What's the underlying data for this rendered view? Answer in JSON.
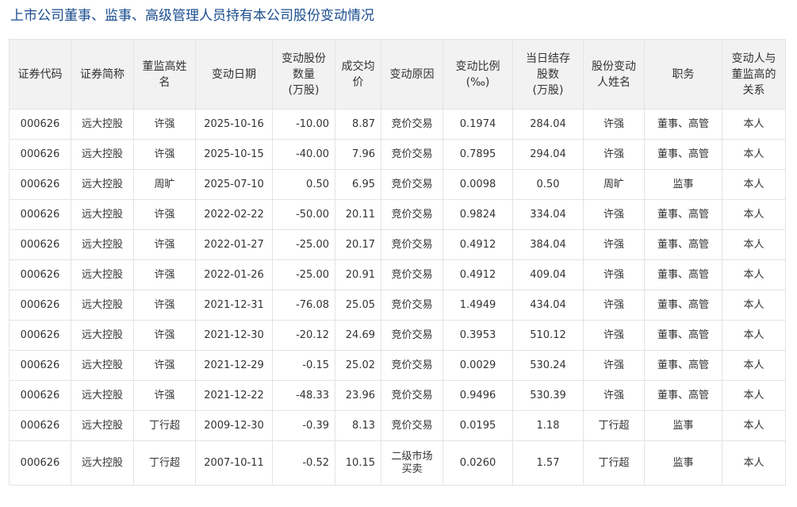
{
  "page": {
    "title": "上市公司董事、监事、高级管理人员持有本公司股份变动情况"
  },
  "table": {
    "headers": [
      "证券代码",
      "证券简称",
      "董监高姓名",
      "变动日期",
      "变动股份数量(万股)",
      "成交均价",
      "变动原因",
      "变动比例(‰)",
      "当日结存股数(万股)",
      "股份变动人姓名",
      "职务",
      "变动人与董监高的关系"
    ],
    "rows": [
      [
        "000626",
        "远大控股",
        "许强",
        "2025-10-16",
        "-10.00",
        "8.87",
        "竞价交易",
        "0.1974",
        "284.04",
        "许强",
        "董事、高管",
        "本人"
      ],
      [
        "000626",
        "远大控股",
        "许强",
        "2025-10-15",
        "-40.00",
        "7.96",
        "竞价交易",
        "0.7895",
        "294.04",
        "许强",
        "董事、高管",
        "本人"
      ],
      [
        "000626",
        "远大控股",
        "周旷",
        "2025-07-10",
        "0.50",
        "6.95",
        "竞价交易",
        "0.0098",
        "0.50",
        "周旷",
        "监事",
        "本人"
      ],
      [
        "000626",
        "远大控股",
        "许强",
        "2022-02-22",
        "-50.00",
        "20.11",
        "竞价交易",
        "0.9824",
        "334.04",
        "许强",
        "董事、高管",
        "本人"
      ],
      [
        "000626",
        "远大控股",
        "许强",
        "2022-01-27",
        "-25.00",
        "20.17",
        "竞价交易",
        "0.4912",
        "384.04",
        "许强",
        "董事、高管",
        "本人"
      ],
      [
        "000626",
        "远大控股",
        "许强",
        "2022-01-26",
        "-25.00",
        "20.91",
        "竞价交易",
        "0.4912",
        "409.04",
        "许强",
        "董事、高管",
        "本人"
      ],
      [
        "000626",
        "远大控股",
        "许强",
        "2021-12-31",
        "-76.08",
        "25.05",
        "竞价交易",
        "1.4949",
        "434.04",
        "许强",
        "董事、高管",
        "本人"
      ],
      [
        "000626",
        "远大控股",
        "许强",
        "2021-12-30",
        "-20.12",
        "24.69",
        "竞价交易",
        "0.3953",
        "510.12",
        "许强",
        "董事、高管",
        "本人"
      ],
      [
        "000626",
        "远大控股",
        "许强",
        "2021-12-29",
        "-0.15",
        "25.02",
        "竞价交易",
        "0.0029",
        "530.24",
        "许强",
        "董事、高管",
        "本人"
      ],
      [
        "000626",
        "远大控股",
        "许强",
        "2021-12-22",
        "-48.33",
        "23.96",
        "竞价交易",
        "0.9496",
        "530.39",
        "许强",
        "董事、高管",
        "本人"
      ],
      [
        "000626",
        "远大控股",
        "丁行超",
        "2009-12-30",
        "-0.39",
        "8.13",
        "竞价交易",
        "0.0195",
        "1.18",
        "丁行超",
        "监事",
        "本人"
      ],
      [
        "000626",
        "远大控股",
        "丁行超",
        "2007-10-11",
        "-0.52",
        "10.15",
        "二级市场买卖",
        "0.0260",
        "1.57",
        "丁行超",
        "监事",
        "本人"
      ]
    ]
  }
}
